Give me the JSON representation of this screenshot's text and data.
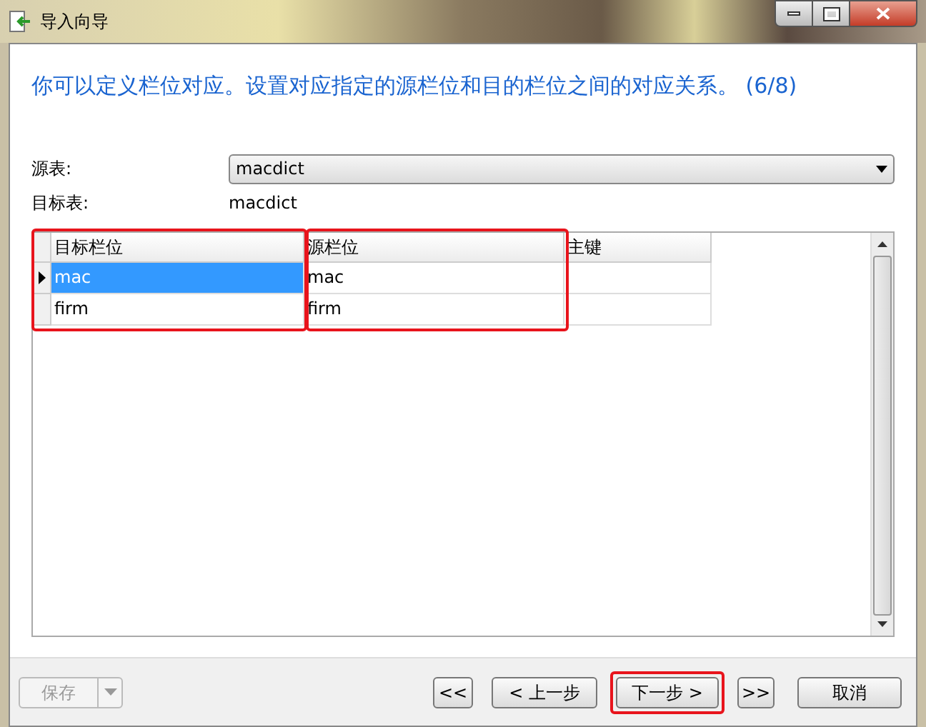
{
  "window": {
    "title": "导入向导"
  },
  "heading": "你可以定义栏位对应。设置对应指定的源栏位和目的栏位之间的对应关系。 (6/8)",
  "source_table": {
    "label": "源表:",
    "value": "macdict"
  },
  "target_table": {
    "label": "目标表:",
    "value": "macdict"
  },
  "grid": {
    "columns": [
      {
        "label": "目标栏位",
        "highlighted": true
      },
      {
        "label": "源栏位",
        "highlighted": true
      },
      {
        "label": "主键",
        "highlighted": false
      }
    ],
    "rows": [
      {
        "cells": [
          "mac",
          "mac"
        ],
        "selected": true
      },
      {
        "cells": [
          "firm",
          "firm"
        ],
        "selected": false
      }
    ]
  },
  "save_button": {
    "label": "保存",
    "disabled": true
  },
  "buttons": [
    {
      "label": "<<",
      "highlighted": false
    },
    {
      "label": "< 上一步",
      "highlighted": false
    },
    {
      "label": "下一步 >",
      "highlighted": true
    },
    {
      "label": ">>",
      "highlighted": false
    },
    {
      "label": "取消",
      "highlighted": false
    }
  ]
}
